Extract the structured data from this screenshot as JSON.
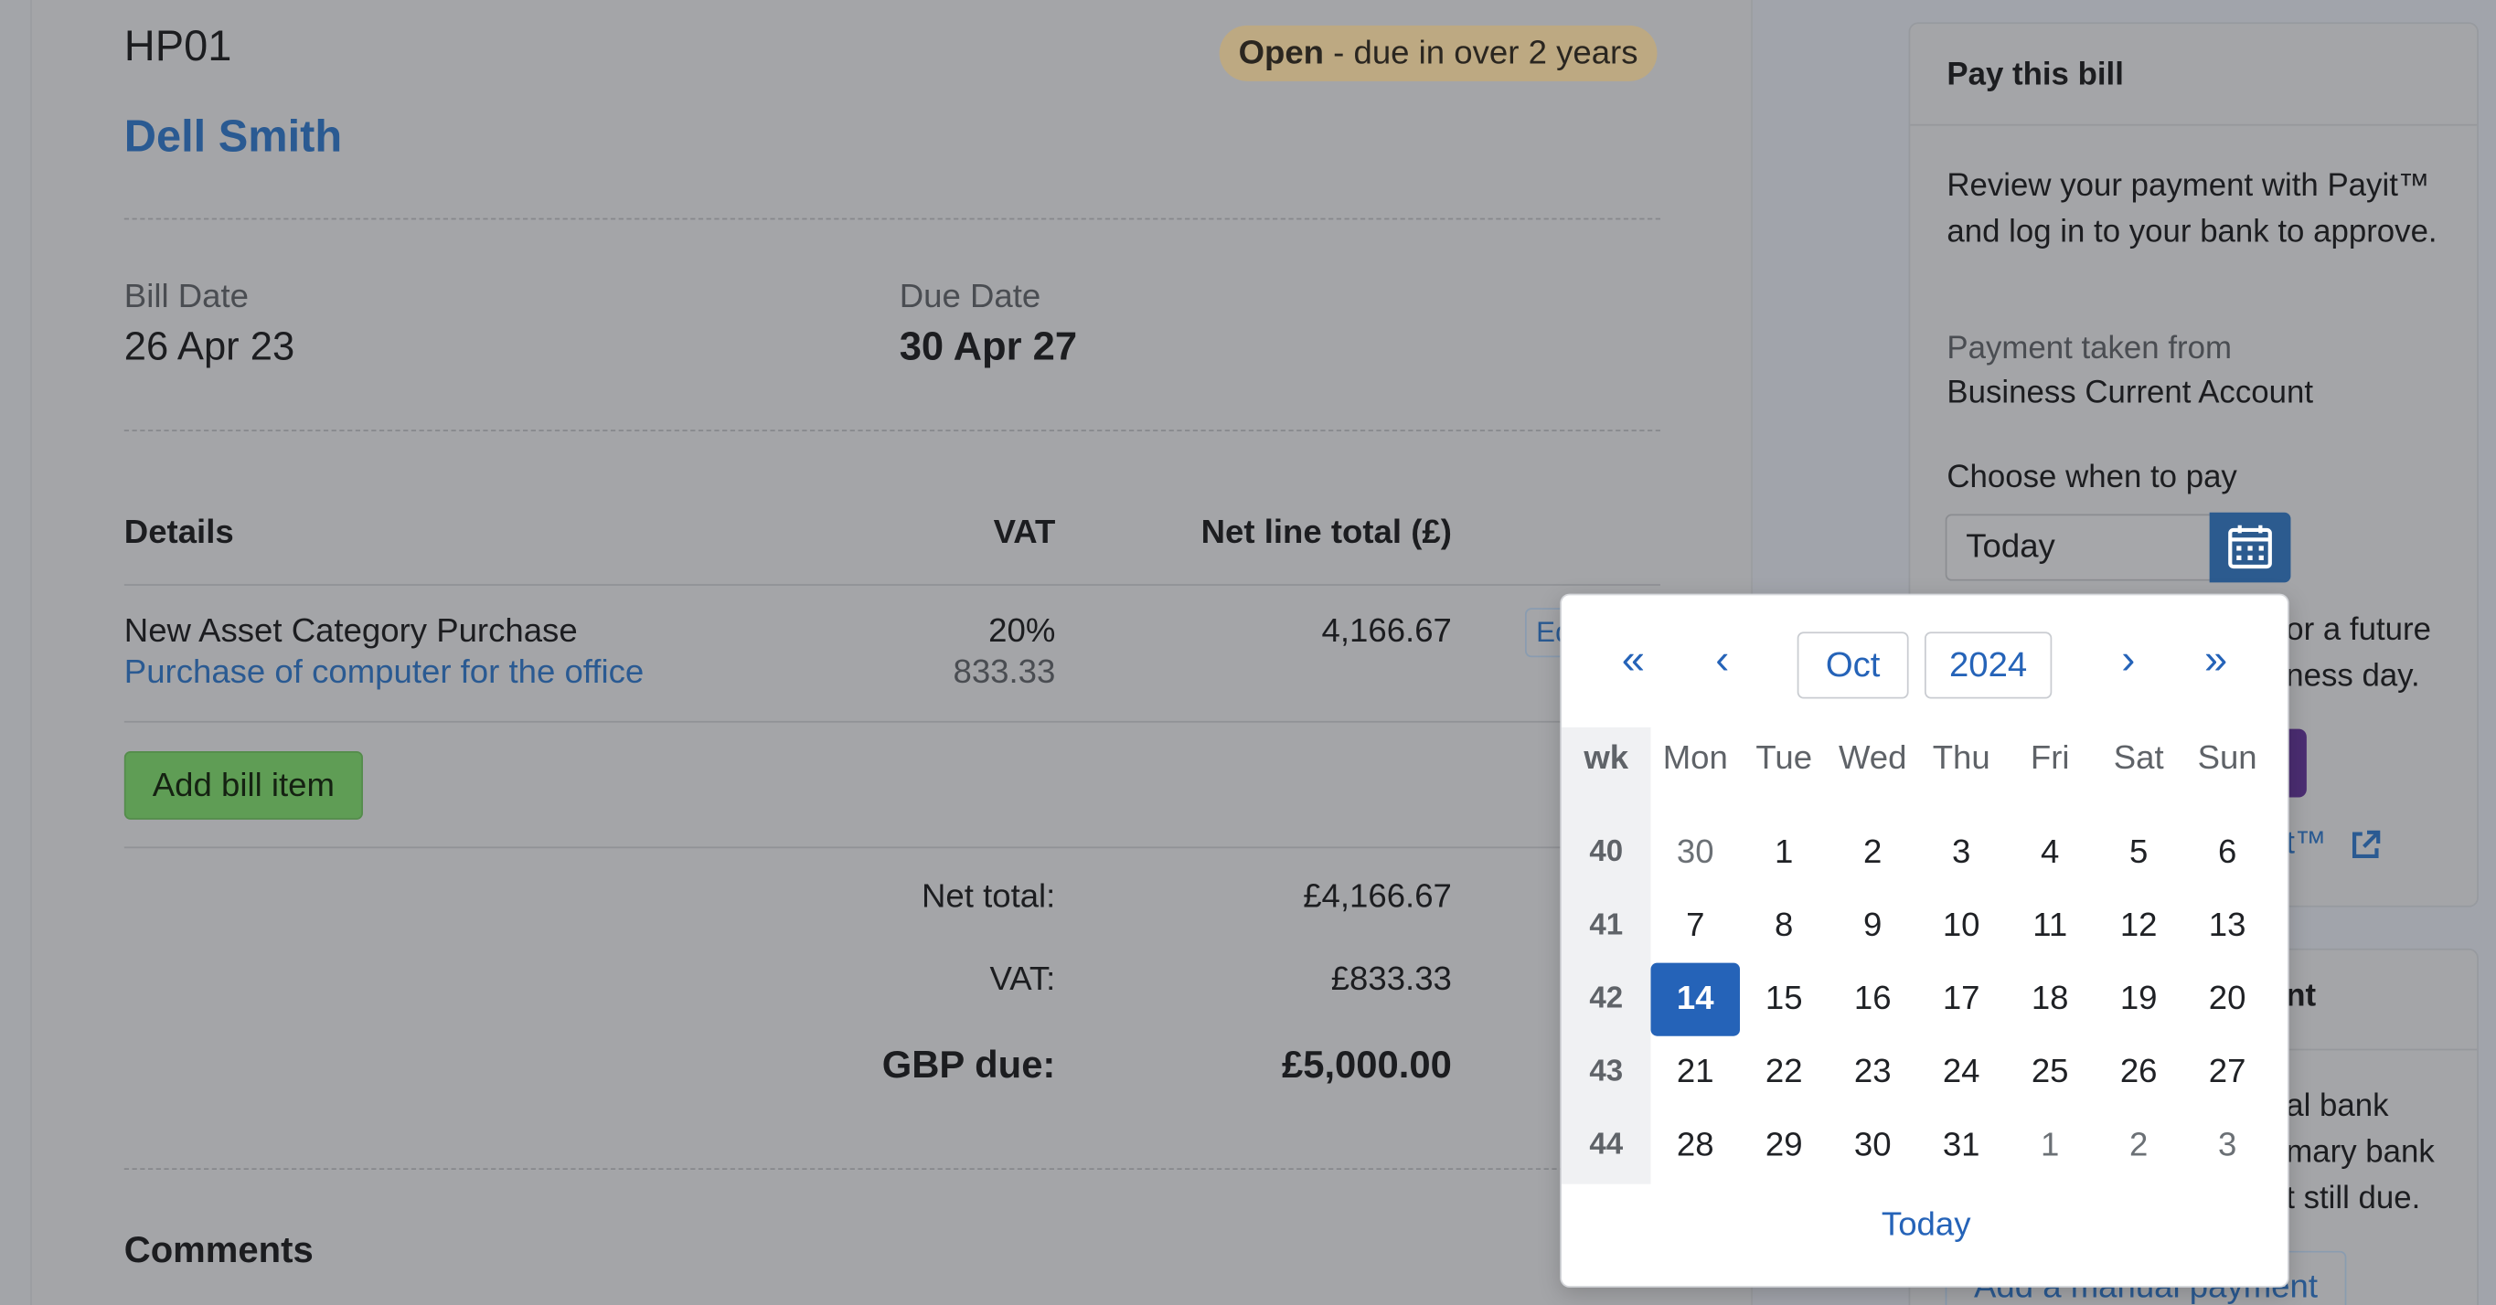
{
  "bill": {
    "reference": "HP01",
    "status_strong": "Open",
    "status_rest": " - due in over 2 years",
    "contact": "Dell Smith",
    "bill_date_label": "Bill Date",
    "bill_date": "26 Apr 23",
    "due_date_label": "Due Date",
    "due_date": "30 Apr 27"
  },
  "table": {
    "headers": {
      "details": "Details",
      "vat": "VAT",
      "net": "Net line total (£)"
    },
    "rows": [
      {
        "title": "New Asset Category Purchase",
        "description": "Purchase of computer for the office",
        "vat_rate": "20%",
        "vat_amount": "833.33",
        "net": "4,166.67",
        "edit_label": "Edit"
      }
    ],
    "add_button": "Add bill item"
  },
  "totals": {
    "net_label": "Net total:",
    "net_value": "£4,166.67",
    "vat_label": "VAT:",
    "vat_value": "£833.33",
    "due_label": "GBP due:",
    "due_value": "£5,000.00"
  },
  "comments_heading": "Comments",
  "pay_panel": {
    "title": "Pay this bill",
    "description": "Review your payment with Payit™ and log in to your bank to approve.",
    "taken_from_label": "Payment taken from",
    "taken_from": "Business Current Account",
    "choose_label": "Choose when to pay",
    "date_value": "Today",
    "peek_line1": "or a future",
    "peek_line2": "ness day.",
    "peek_link": "t™"
  },
  "manual_panel": {
    "title_peek": "nt",
    "peek_line1": "al bank",
    "peek_line2": "mary bank",
    "peek_line3": "t still due.",
    "button": "Add a manual payment"
  },
  "datepicker": {
    "month": "Oct",
    "year": "2024",
    "nav": {
      "prev_year": "«",
      "prev_month": "‹",
      "next_month": "›",
      "next_year": "»"
    },
    "week_header": "wk",
    "weekdays": [
      "Mon",
      "Tue",
      "Wed",
      "Thu",
      "Fri",
      "Sat",
      "Sun"
    ],
    "weeks": [
      {
        "wk": "40",
        "days": [
          "30",
          "1",
          "2",
          "3",
          "4",
          "5",
          "6"
        ]
      },
      {
        "wk": "41",
        "days": [
          "7",
          "8",
          "9",
          "10",
          "11",
          "12",
          "13"
        ]
      },
      {
        "wk": "42",
        "days": [
          "14",
          "15",
          "16",
          "17",
          "18",
          "19",
          "20"
        ]
      },
      {
        "wk": "43",
        "days": [
          "21",
          "22",
          "23",
          "24",
          "25",
          "26",
          "27"
        ]
      },
      {
        "wk": "44",
        "days": [
          "28",
          "29",
          "30",
          "31",
          "1",
          "2",
          "3"
        ]
      }
    ],
    "selected": "14",
    "today_label": "Today",
    "colors": {
      "accent": "#2563b8"
    }
  }
}
